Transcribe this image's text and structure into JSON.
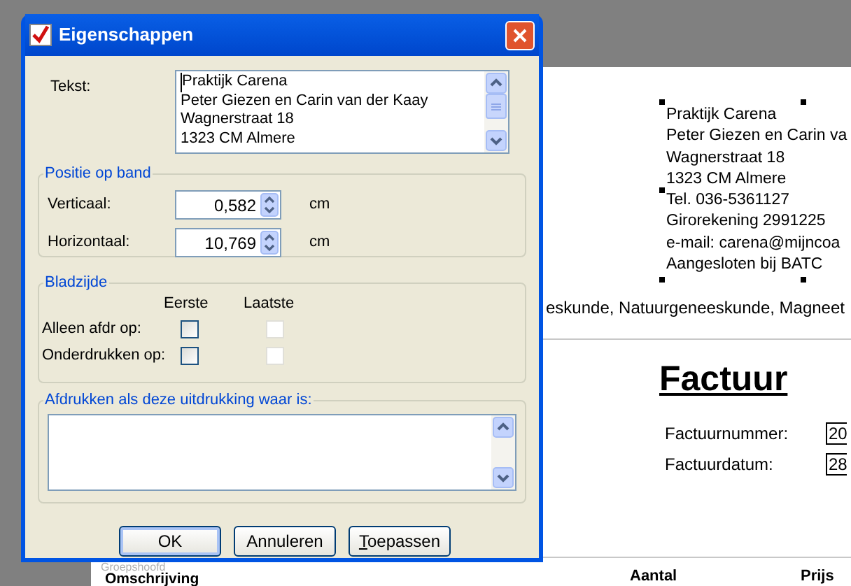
{
  "report": {
    "header_lines": [
      "Praktijk Carena",
      "Peter Giezen en Carin va",
      "Wagnerstraat 18",
      "1323 CM Almere",
      "Tel. 036-5361127",
      "Girorekening 2991225",
      "e-mail: carena@mijncoa",
      "Aangesloten bij BATC"
    ],
    "tagline": "eskunde, Natuurgeneeskunde, Magneet",
    "title": "Factuur",
    "fields": [
      {
        "label": "Factuurnummer:",
        "value": "20"
      },
      {
        "label": "Factuurdatum:",
        "value": "28"
      }
    ],
    "band_label": "Groepshoofd",
    "columns": [
      "Omschrijving",
      "Aantal",
      "Prijs"
    ]
  },
  "dialog": {
    "title": "Eigenschappen",
    "text_label": "Tekst:",
    "text_lines": [
      "Praktijk Carena",
      "Peter Giezen en Carin van der Kaay",
      "Wagnerstraat 18",
      "1323 CM Almere"
    ],
    "position": {
      "legend": "Positie op band",
      "rows": [
        {
          "label": "Verticaal:",
          "value": "0,582",
          "unit": "cm"
        },
        {
          "label": "Horizontaal:",
          "value": "10,769",
          "unit": "cm"
        }
      ]
    },
    "page": {
      "legend": "Bladzijde",
      "columns": [
        "Eerste",
        "Laatste"
      ],
      "rows": [
        {
          "label": "Alleen afdr op:",
          "checks": [
            {
              "checked": false,
              "disabled": false
            },
            {
              "checked": false,
              "disabled": true
            }
          ]
        },
        {
          "label": "Onderdrukken op:",
          "checks": [
            {
              "checked": false,
              "disabled": false
            },
            {
              "checked": false,
              "disabled": true
            }
          ]
        }
      ]
    },
    "condition": {
      "legend": "Afdrukken als deze uitdrukking waar is:"
    },
    "buttons": [
      {
        "label": "OK",
        "default": true
      },
      {
        "label": "Annuleren",
        "default": false
      },
      {
        "label": "Toepassen",
        "default": false,
        "mnemonic": true
      }
    ]
  }
}
